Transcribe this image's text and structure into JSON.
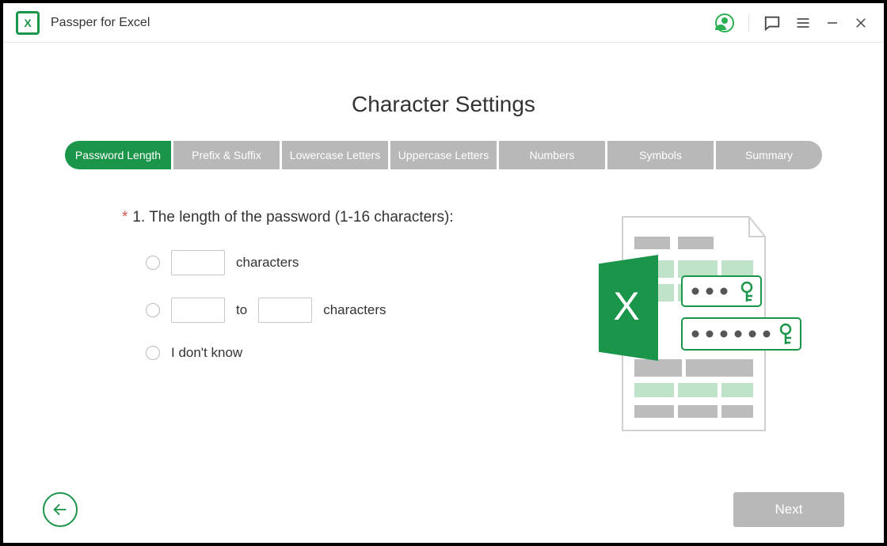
{
  "app": {
    "title": "Passper for Excel",
    "icon_letter": "X"
  },
  "heading": "Character Settings",
  "tabs": [
    {
      "label": "Password Length",
      "active": true
    },
    {
      "label": "Prefix & Suffix",
      "active": false
    },
    {
      "label": "Lowercase Letters",
      "active": false
    },
    {
      "label": "Uppercase Letters",
      "active": false
    },
    {
      "label": "Numbers",
      "active": false
    },
    {
      "label": "Symbols",
      "active": false
    },
    {
      "label": "Summary",
      "active": false
    }
  ],
  "question": {
    "required_mark": "*",
    "text": "1. The length of the password (1-16 characters):"
  },
  "options": {
    "exact": {
      "value": "",
      "unit": "characters"
    },
    "range": {
      "from": "",
      "to": "",
      "sep": "to",
      "unit": "characters"
    },
    "unknown": {
      "label": "I don't know"
    }
  },
  "footer": {
    "next_label": "Next"
  }
}
